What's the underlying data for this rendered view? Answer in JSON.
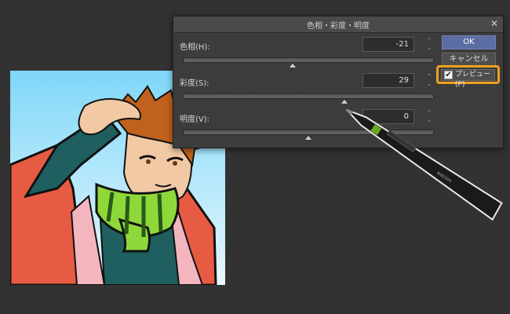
{
  "dialog": {
    "title": "色相・彩度・明度",
    "close_symbol": "✕",
    "hue": {
      "label": "色相(H):",
      "value": "-21",
      "level": -21
    },
    "saturation": {
      "label": "彩度(S):",
      "value": "29",
      "level": 29
    },
    "brightness": {
      "label": "明度(V):",
      "value": "0",
      "level": 0
    },
    "ok_label": "OK",
    "cancel_label": "キャンセル",
    "preview_label": "プレビュー(P)",
    "preview_checked": true,
    "check_symbol": "✔",
    "spin_up": "⌃",
    "spin_down": "⌄"
  },
  "pen": {
    "brand": "wacom"
  },
  "colors": {
    "background": "#323232",
    "ok_button": "#5b6ea3",
    "highlight": "#f0a020",
    "sky": "#7fd7f7"
  }
}
